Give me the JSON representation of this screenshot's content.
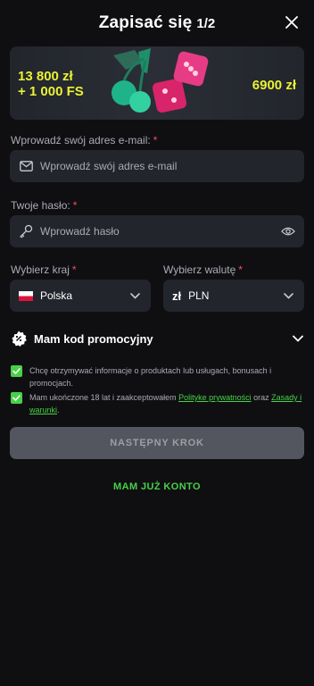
{
  "header": {
    "title": "Zapisać się",
    "step": "1/2",
    "close_icon": "close-icon"
  },
  "banner": {
    "left_line1": "13 800 zł",
    "left_line2": "+ 1 000 FS",
    "right_value": "6900 zł",
    "accent_color": "#e9f233"
  },
  "email": {
    "label": "Wprowadź swój adres e-mail:",
    "required_mark": "*",
    "placeholder": "Wprowadź swój adres e-mail",
    "icon": "envelope-icon"
  },
  "password": {
    "label": "Twoje hasło:",
    "required_mark": "*",
    "placeholder": "Wprowadź hasło",
    "icon": "key-icon",
    "toggle_icon": "eye-icon"
  },
  "country": {
    "label": "Wybierz kraj",
    "required_mark": "*",
    "value": "Polska",
    "icon": "poland-flag-icon"
  },
  "currency": {
    "label": "Wybierz walutę",
    "required_mark": "*",
    "symbol": "zł",
    "value": "PLN"
  },
  "promo": {
    "label": "Mam kod promocyjny",
    "icon": "percent-badge-icon"
  },
  "consents": {
    "marketing_text": "Chcę otrzymywać informacje o produktach lub usługach, bonusach i promocjach.",
    "terms_prefix": "Mam ukończone 18 lat i zaakceptowałem ",
    "privacy_link": "Polityke prywatności",
    "terms_middle": " oraz ",
    "terms_link": "Zasady i warunki",
    "terms_suffix": "."
  },
  "actions": {
    "next_label": "NASTĘPNY KROK",
    "login_label": "MAM JUŻ KONTO"
  },
  "colors": {
    "background": "#0f0f12",
    "field": "#23252c",
    "green": "#47d147",
    "required": "#ff4b55",
    "button_disabled": "#54565f"
  }
}
